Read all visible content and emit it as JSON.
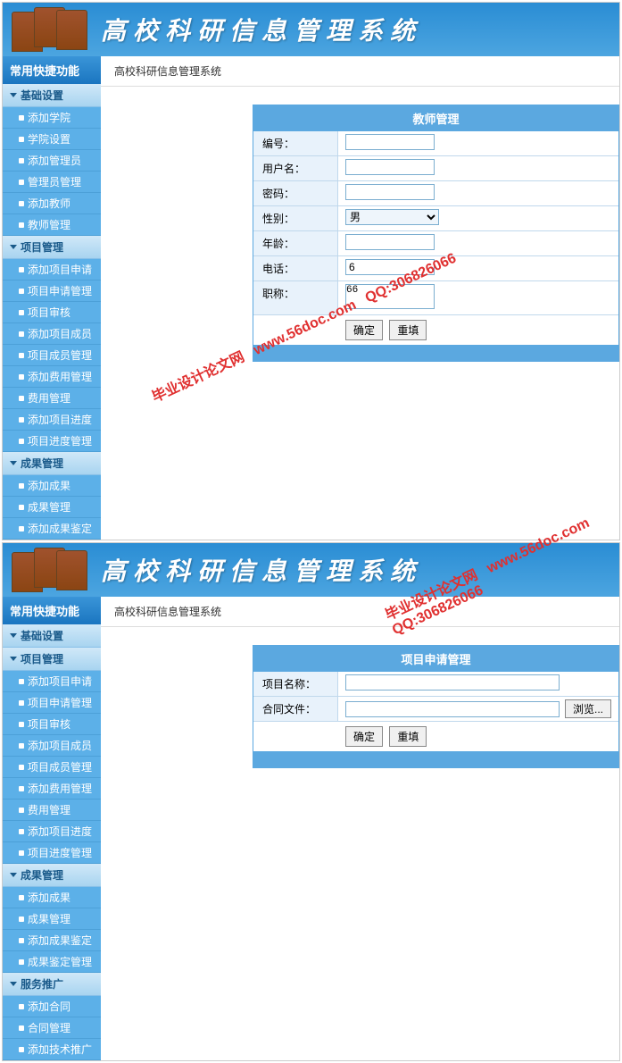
{
  "header_title": "高校科研信息管理系统",
  "sidebar_title": "常用快捷功能",
  "breadcrumb": "高校科研信息管理系统",
  "watermark": {
    "site": "www.56doc.com",
    "qq": "QQ:306826066",
    "name": "毕业设计论文网"
  },
  "panel1": {
    "title": "教师管理",
    "sections": [
      {
        "label": "基础设置",
        "items": [
          "添加学院",
          "学院设置",
          "添加管理员",
          "管理员管理",
          "添加教师",
          "教师管理"
        ]
      },
      {
        "label": "项目管理",
        "items": [
          "添加项目申请",
          "项目申请管理",
          "项目审核",
          "添加项目成员",
          "项目成员管理",
          "添加费用管理",
          "费用管理",
          "添加项目进度",
          "项目进度管理"
        ]
      },
      {
        "label": "成果管理",
        "items": [
          "添加成果",
          "成果管理",
          "添加成果鉴定"
        ]
      }
    ],
    "fields": {
      "id_label": "编号：",
      "username_label": "用户名：",
      "password_label": "密码：",
      "gender_label": "性别：",
      "gender_value": "男",
      "age_label": "年龄：",
      "phone_label": "电话：",
      "phone_value": "6",
      "title_label": "职称：",
      "title_value": "66"
    },
    "buttons": {
      "submit": "确定",
      "reset": "重填"
    }
  },
  "panel2": {
    "title": "项目申请管理",
    "sections": [
      {
        "label": "基础设置",
        "items": []
      },
      {
        "label": "项目管理",
        "items": [
          "添加项目申请",
          "项目申请管理",
          "项目审核",
          "添加项目成员",
          "项目成员管理",
          "添加费用管理",
          "费用管理",
          "添加项目进度",
          "项目进度管理"
        ]
      },
      {
        "label": "成果管理",
        "items": [
          "添加成果",
          "成果管理",
          "添加成果鉴定",
          "成果鉴定管理"
        ]
      },
      {
        "label": "服务推广",
        "items": [
          "添加合同",
          "合同管理",
          "添加技术推广"
        ]
      }
    ],
    "fields": {
      "project_name_label": "项目名称：",
      "contract_file_label": "合同文件：",
      "browse": "浏览..."
    },
    "buttons": {
      "submit": "确定",
      "reset": "重填"
    }
  }
}
